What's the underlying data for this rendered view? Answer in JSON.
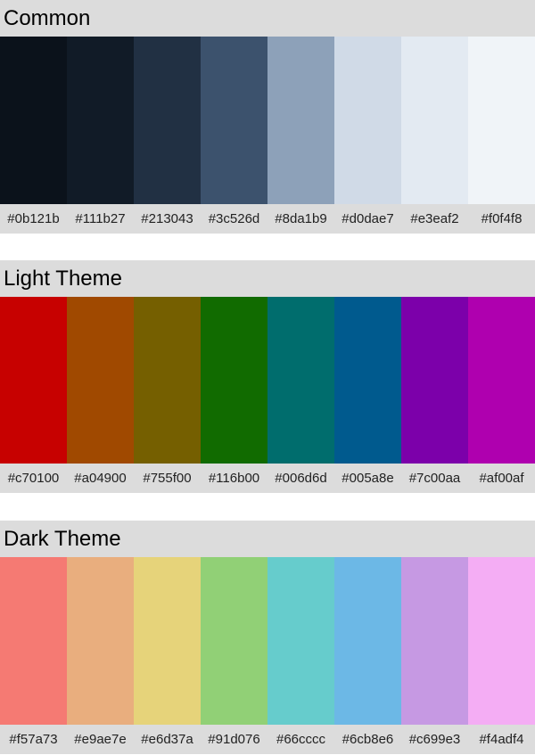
{
  "palettes": [
    {
      "title": "Common",
      "colors": [
        "#0b121b",
        "#111b27",
        "#213043",
        "#3c526d",
        "#8da1b9",
        "#d0dae7",
        "#e3eaf2",
        "#f0f4f8"
      ]
    },
    {
      "title": "Light Theme",
      "colors": [
        "#c70100",
        "#a04900",
        "#755f00",
        "#116b00",
        "#006d6d",
        "#005a8e",
        "#7c00aa",
        "#af00af"
      ]
    },
    {
      "title": "Dark Theme",
      "colors": [
        "#f57a73",
        "#e9ae7e",
        "#e6d37a",
        "#91d076",
        "#66cccc",
        "#6cb8e6",
        "#c699e3",
        "#f4adf4"
      ]
    }
  ]
}
